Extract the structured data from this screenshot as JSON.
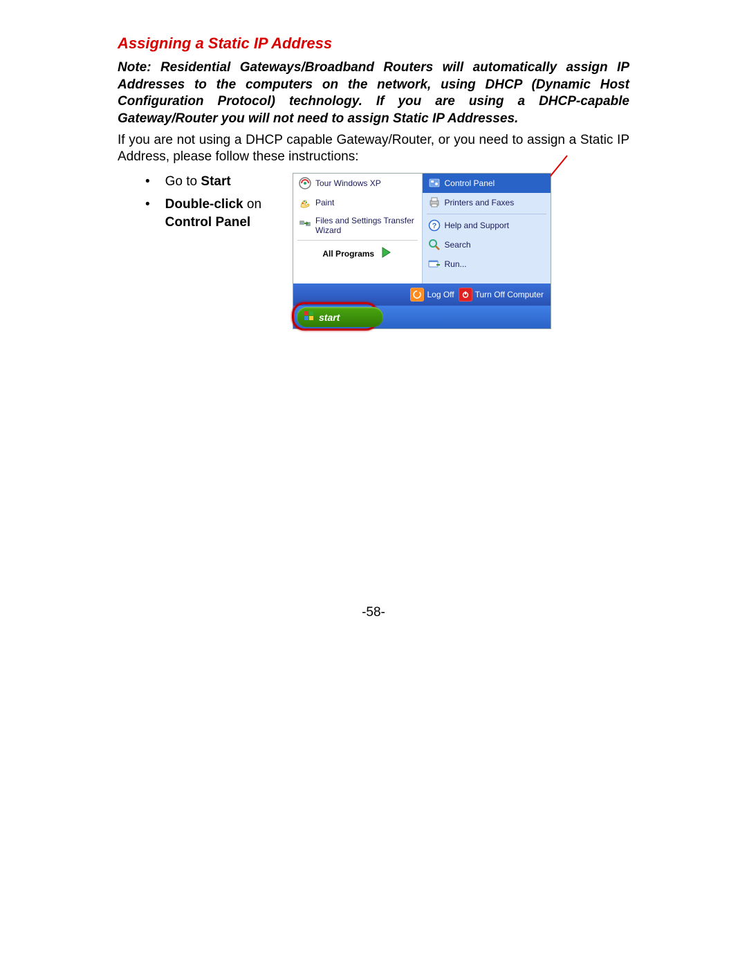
{
  "heading": "Assigning a Static IP Address",
  "note": "Note:   Residential Gateways/Broadband Routers will automatically assign IP Addresses to the computers on the network, using DHCP (Dynamic Host Configuration Protocol) technology.   If you are using a DHCP-capable Gateway/Router you will not need to assign Static IP Addresses.",
  "lead": "If you are not using a DHCP capable Gateway/Router, or you need to assign a Static IP Address, please follow these instructions:",
  "instr": {
    "b": "•",
    "i1_pre": "Go to ",
    "i1_b": "Start",
    "i2_b1": "Double-click",
    "i2_mid": " on ",
    "i2_b2": "Control Panel"
  },
  "menu": {
    "left": {
      "tour": "Tour Windows XP",
      "paint": "Paint",
      "fst1": "Files and Settings Transfer",
      "fst2": "Wizard",
      "allp": "All Programs"
    },
    "right": {
      "cp": "Control Panel",
      "pf": "Printers and Faxes",
      "hs": "Help and Support",
      "se": "Search",
      "ru": "Run..."
    },
    "bottom": {
      "log": "Log Off",
      "off": "Turn Off Computer"
    },
    "start": "start"
  },
  "pagenum": "-58-"
}
